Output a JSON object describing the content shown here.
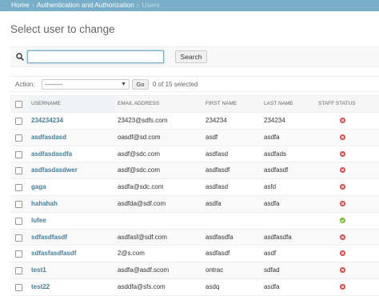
{
  "breadcrumbs": {
    "home": "Home",
    "section": "Authentication and Authorization",
    "current": "Users",
    "separator": "›"
  },
  "page": {
    "title": "Select user to change"
  },
  "search": {
    "value": "",
    "placeholder": "",
    "button_label": "Search",
    "icon": "search-icon"
  },
  "actions": {
    "label": "Action:",
    "selected": "---------",
    "go_label": "Go",
    "selection_count": "0 of 15 selected"
  },
  "table": {
    "columns": {
      "username": "USERNAME",
      "email": "EMAIL ADDRESS",
      "first_name": "FIRST NAME",
      "last_name": "LAST NAME",
      "staff_status": "STAFF STATUS"
    },
    "sort_indicator": "▲",
    "rows": [
      {
        "username": "234234234",
        "email": "23423@sdfs.com",
        "first_name": "234234",
        "last_name": "234234",
        "staff": false
      },
      {
        "username": "asdfasdasd",
        "email": "oasdf@sd.com",
        "first_name": "asdf",
        "last_name": "asdfa",
        "staff": false
      },
      {
        "username": "asdfasdasdfa",
        "email": "asdf@sdc.com",
        "first_name": "asdfasd",
        "last_name": "asdfads",
        "staff": false
      },
      {
        "username": "asdfasdasdwer",
        "email": "asdf@sdc.com",
        "first_name": "asdfasdf",
        "last_name": "asdfasdf",
        "staff": false
      },
      {
        "username": "gaga",
        "email": "asdfa@sdc.com",
        "first_name": "asdfasd",
        "last_name": "asfd",
        "staff": false
      },
      {
        "username": "hahahah",
        "email": "asdfda@sdf.com",
        "first_name": "asdfa",
        "last_name": "asdfa",
        "staff": false
      },
      {
        "username": "lufee",
        "email": "",
        "first_name": "",
        "last_name": "",
        "staff": true
      },
      {
        "username": "sdfasdfasdf",
        "email": "asdfasf@sdf.com",
        "first_name": "asdfasdfa",
        "last_name": "asdfasdfa",
        "staff": false
      },
      {
        "username": "sdfasfasdfasdf",
        "email": "2@s.com",
        "first_name": "asdfasdf",
        "last_name": "asdf",
        "staff": false
      },
      {
        "username": "test1",
        "email": "asdfa@asdf.scom",
        "first_name": "ontrac",
        "last_name": "sdfad",
        "staff": false
      },
      {
        "username": "test22",
        "email": "asddfa@sfs.com",
        "first_name": "asdq",
        "last_name": "asdfa",
        "staff": false
      }
    ]
  },
  "colors": {
    "breadcrumb_bg": "#79aec8",
    "link": "#447e9b",
    "staff_no": "#dd4646",
    "staff_yes": "#70bf2b"
  }
}
